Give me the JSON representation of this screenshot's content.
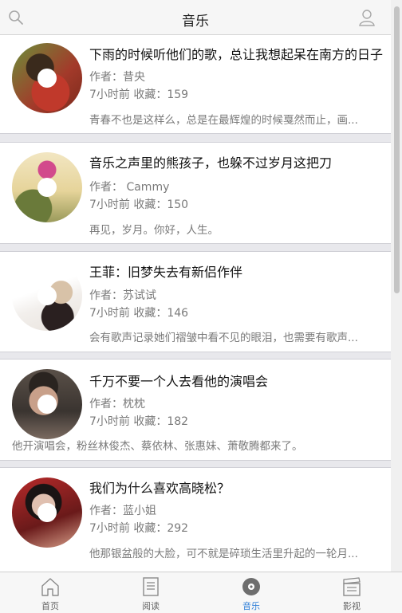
{
  "header": {
    "title": "音乐",
    "left_icon": "search-icon",
    "right_icon": "user-icon"
  },
  "articles": [
    {
      "title": "下雨的时候听他们的歌，总让我想起呆在南方的日子",
      "author": "作者：昔央",
      "meta": "7小时前 收藏：159",
      "excerpt": "青春不也是这样么，总是在最辉煌的时候戛然而止，画..."
    },
    {
      "title": "音乐之声里的熊孩子，也躲不过岁月这把刀",
      "author": "作者： Cammy",
      "meta": "7小时前 收藏：150",
      "excerpt": "再见，岁月。你好，人生。"
    },
    {
      "title": "王菲：旧梦失去有新侣作伴",
      "author": "作者：苏试试",
      "meta": "7小时前 收藏：146",
      "excerpt": "会有歌声记录她们褶皱中看不见的眼泪，也需要有歌声..."
    },
    {
      "title": "千万不要一个人去看他的演唱会",
      "author": "作者：枕枕",
      "meta": "7小时前 收藏：182",
      "excerpt": "他开演唱会，粉丝林俊杰、蔡依林、张惠妹、萧敬腾都来了。"
    },
    {
      "title": "我们为什么喜欢高晓松？",
      "author": "作者：蓝小姐",
      "meta": "7小时前 收藏：292",
      "excerpt": "他那银盆般的大脸，可不就是碎琐生活里升起的一轮月..."
    }
  ],
  "tabs": [
    {
      "label": "首页",
      "icon": "home-icon",
      "active": false
    },
    {
      "label": "阅读",
      "icon": "book-icon",
      "active": false
    },
    {
      "label": "音乐",
      "icon": "music-disc-icon",
      "active": true
    },
    {
      "label": "影视",
      "icon": "clapperboard-icon",
      "active": false
    }
  ],
  "colors": {
    "active_tab": "#2f7fd8",
    "background": "#e8e8ec"
  }
}
